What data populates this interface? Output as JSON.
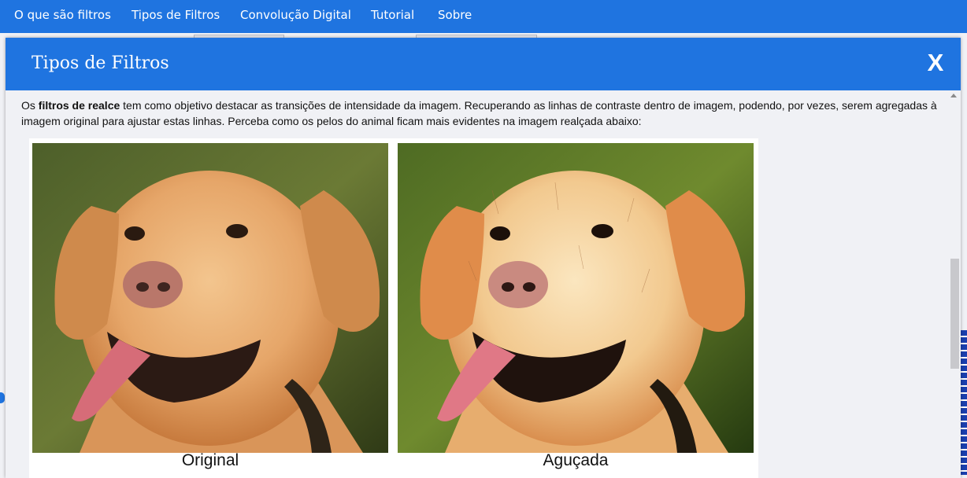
{
  "nav": {
    "items": [
      {
        "label": "O que são filtros"
      },
      {
        "label": "Tipos de Filtros"
      },
      {
        "label": "Convolução Digital"
      },
      {
        "label": "Tutorial"
      },
      {
        "label": "Sobre"
      }
    ]
  },
  "modal": {
    "title": "Tipos de Filtros",
    "close_label": "X",
    "paragraph": {
      "prefix": "Os ",
      "bold": "filtros de realce",
      "suffix": " tem como objetivo destacar as transições de intensidade da imagem. Recuperando as linhas de contraste dentro de imagem, podendo, por vezes, serem agregadas à imagem original para ajustar estas linhas. Perceba como os pelos do animal ficam mais evidentes na imagem realçada abaixo:"
    },
    "figure": {
      "left_caption": "Original",
      "right_caption": "Aguçada"
    }
  },
  "colors": {
    "brand_blue": "#1f74e0",
    "background": "#f0f1f5"
  }
}
